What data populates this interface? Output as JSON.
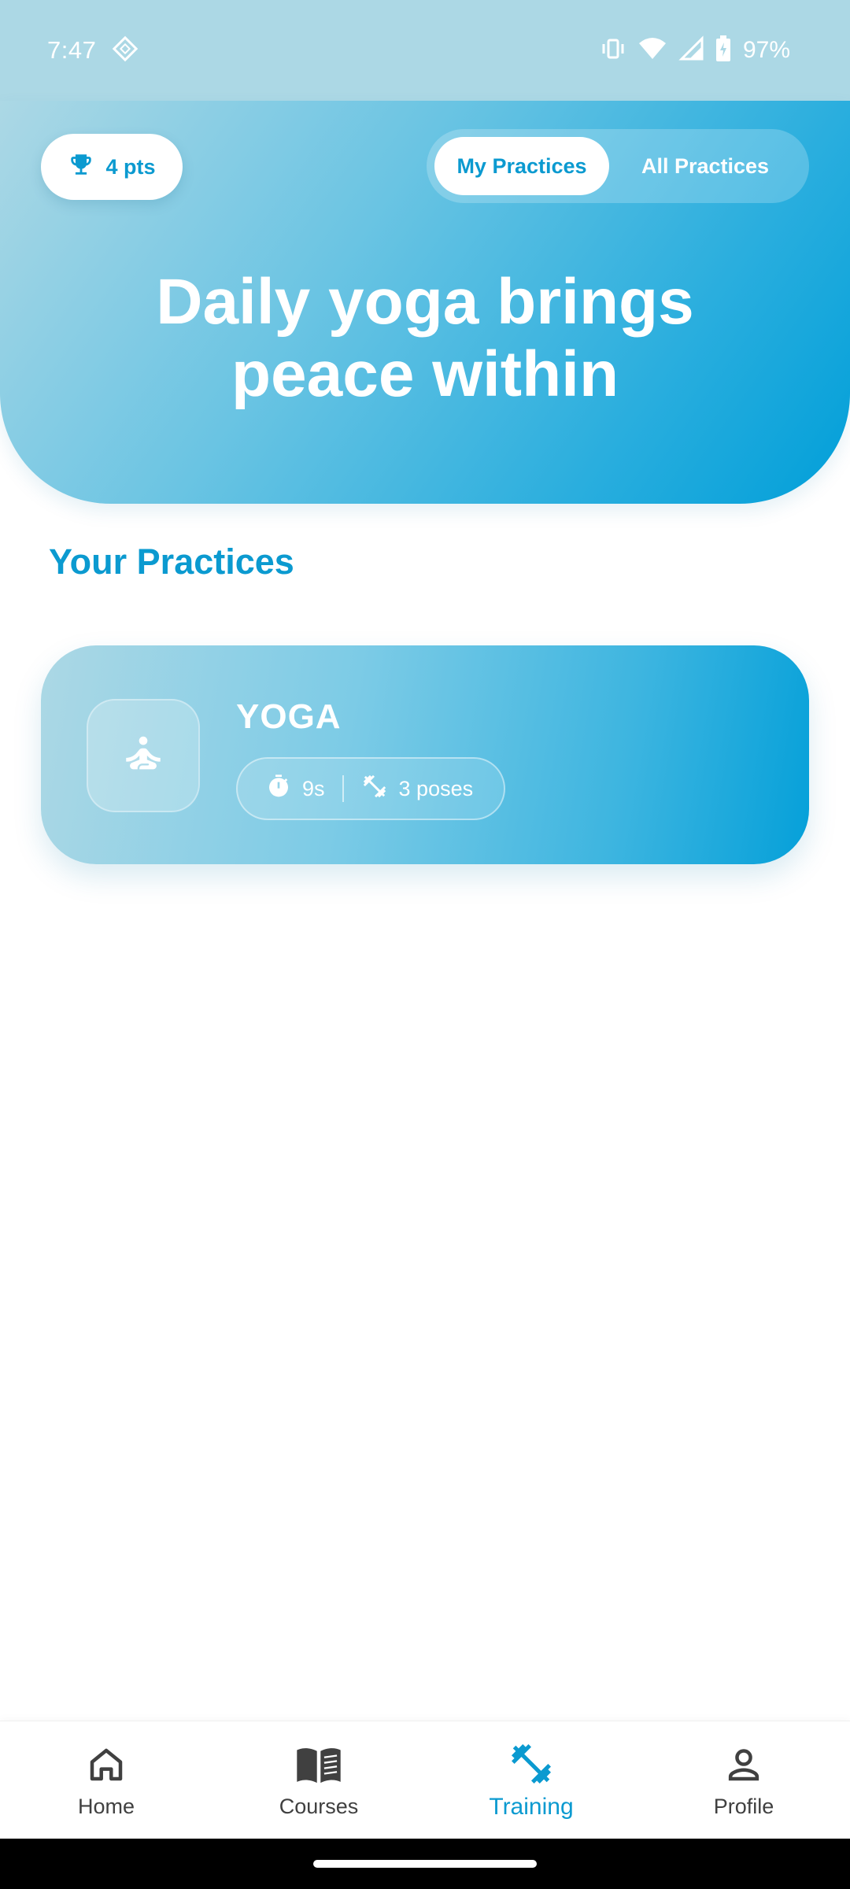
{
  "status_bar": {
    "time": "7:47",
    "battery": "97%",
    "icons": [
      "diamond-icon",
      "vibrate-icon",
      "wifi-icon",
      "signal-icon",
      "battery-icon"
    ]
  },
  "header": {
    "points": "4 pts",
    "points_icon": "trophy-icon",
    "tabs": [
      {
        "label": "My Practices",
        "active": true
      },
      {
        "label": "All Practices",
        "active": false
      }
    ],
    "title": "Daily yoga brings\npeace within"
  },
  "section": {
    "title": "Your Practices"
  },
  "practices": [
    {
      "title": "YOGA",
      "icon": "meditation-icon",
      "duration": "9s",
      "poses": "3 poses"
    }
  ],
  "bottom_nav": {
    "items": [
      {
        "label": "Home",
        "icon": "home-icon",
        "active": false
      },
      {
        "label": "Courses",
        "icon": "book-icon",
        "active": false
      },
      {
        "label": "Training",
        "icon": "dumbbell-icon",
        "active": true
      },
      {
        "label": "Profile",
        "icon": "person-icon",
        "active": false
      }
    ]
  },
  "colors": {
    "accent": "#0b9ad0",
    "hero_light": "#acd8e5",
    "hero_dark": "#019fd9",
    "nav_inactive": "#404040"
  }
}
